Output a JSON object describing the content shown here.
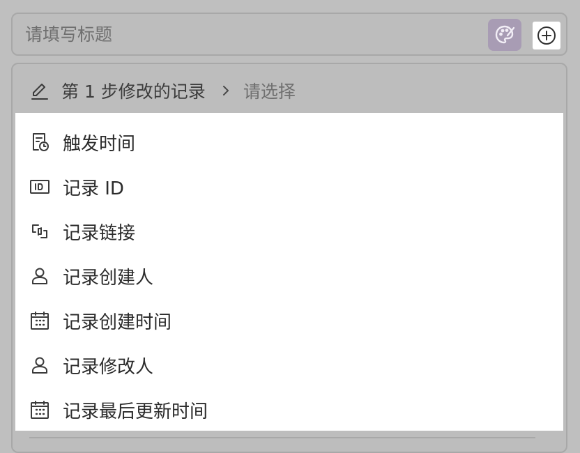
{
  "title": {
    "placeholder": "请填写标题",
    "palette_icon": "palette-icon",
    "add_icon": "plus-circle-icon"
  },
  "breadcrumb": {
    "icon": "pencil-icon",
    "step_label": "第 1 步修改的记录",
    "separator_icon": "chevron-right-icon",
    "placeholder": "请选择"
  },
  "menu": {
    "items": [
      {
        "label": "触发时间",
        "icon": "clock-document-icon"
      },
      {
        "label": "记录 ID",
        "icon": "id-card-icon"
      },
      {
        "label": "记录链接",
        "icon": "link-icon"
      },
      {
        "label": "记录创建人",
        "icon": "user-icon"
      },
      {
        "label": "记录创建时间",
        "icon": "calendar-icon"
      },
      {
        "label": "记录修改人",
        "icon": "user-icon"
      },
      {
        "label": "记录最后更新时间",
        "icon": "calendar-icon"
      }
    ]
  },
  "colors": {
    "overlay": "#bfbfbf",
    "palette_button": "#a89cb4",
    "dropdown_bg": "#ffffff",
    "icon_stroke": "#3a3a3a"
  }
}
